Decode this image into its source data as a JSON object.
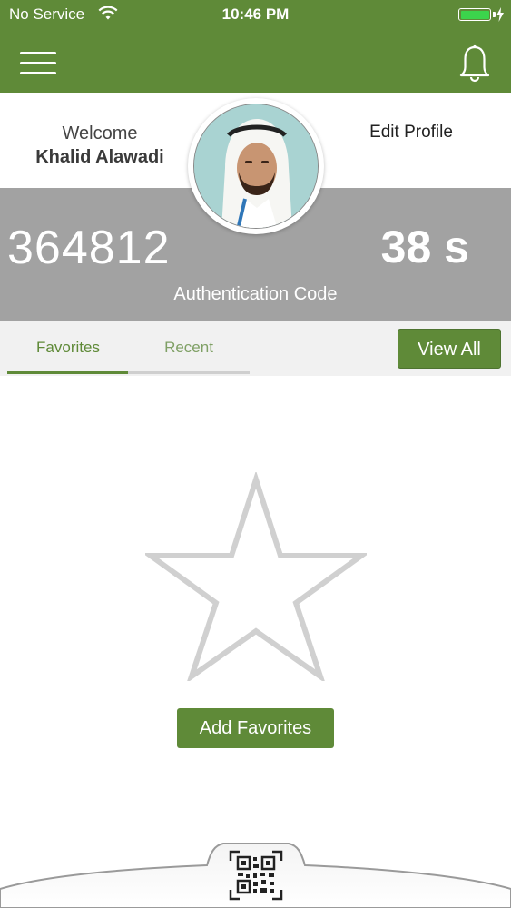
{
  "status_bar": {
    "carrier": "No Service",
    "time": "10:46 PM",
    "battery_color": "#3cd44c"
  },
  "nav": {
    "menu_icon": "hamburger-menu-icon",
    "notification_icon": "bell-icon",
    "background_color": "#5f8a38"
  },
  "profile": {
    "welcome_label": "Welcome",
    "user_name": "Khalid Alawadi",
    "edit_label": "Edit Profile",
    "avatar_icon": "user-avatar"
  },
  "auth": {
    "code": "364812",
    "timer": "38 s",
    "label": "Authentication Code"
  },
  "tabs": [
    {
      "label": "Favorites",
      "active": true
    },
    {
      "label": "Recent",
      "active": false
    }
  ],
  "view_all_label": "View All",
  "empty_state": {
    "icon": "star-outline-icon",
    "add_label": "Add Favorites"
  },
  "dock": {
    "qr_icon": "qr-code-scan-icon"
  },
  "colors": {
    "accent": "#5f8a38",
    "band": "#a2a2a2",
    "tab_background": "#f1f1f1"
  }
}
